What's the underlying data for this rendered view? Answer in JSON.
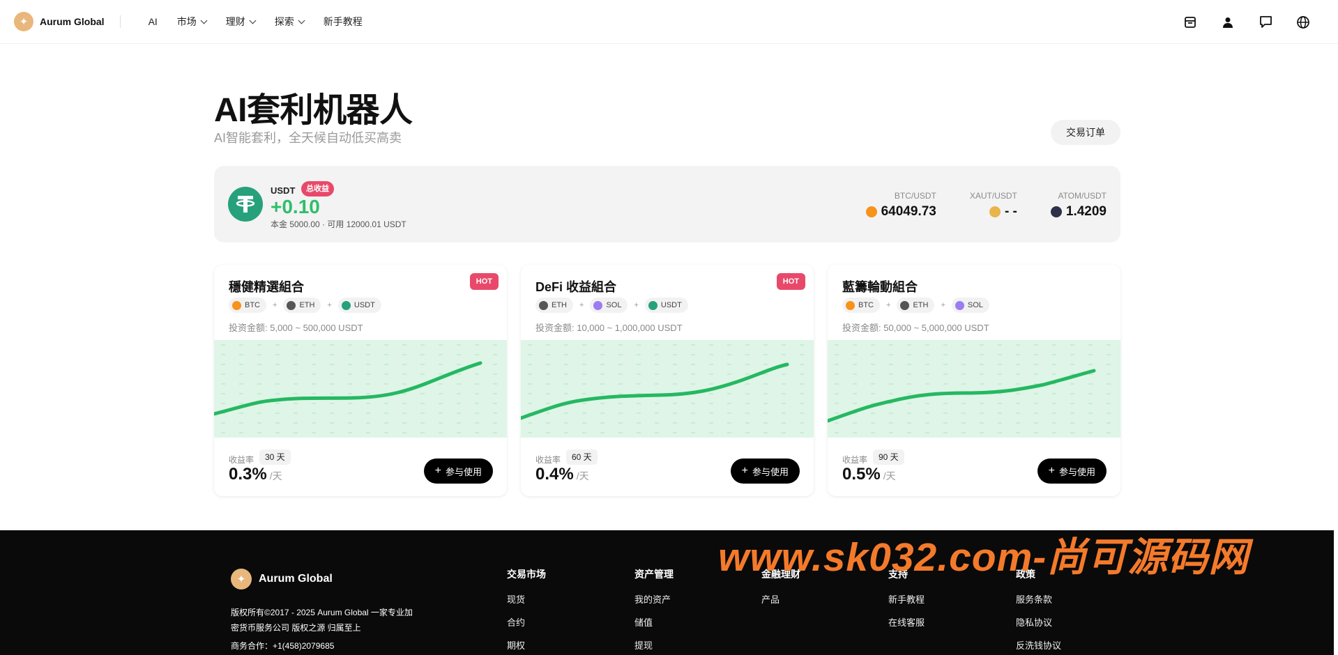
{
  "header": {
    "brand": "Aurum Global",
    "nav": [
      {
        "label": "AI",
        "dropdown": false
      },
      {
        "label": "市场",
        "dropdown": true
      },
      {
        "label": "理财",
        "dropdown": true
      },
      {
        "label": "探索",
        "dropdown": true
      },
      {
        "label": "新手教程",
        "dropdown": false
      }
    ],
    "icons": [
      "wallet-icon",
      "user-icon",
      "chat-icon",
      "globe-icon"
    ]
  },
  "page": {
    "title": "AI套利机器人",
    "subtitle": "AI智能套利，全天候自动低买高卖",
    "orders_button": "交易订单"
  },
  "summary": {
    "currency": "USDT",
    "badge": "总收益",
    "profit": "+0.10",
    "capital": "本金 5000.00 · 可用 12000.01 USDT",
    "tickers": [
      {
        "pair": "BTC/USDT",
        "price": "64049.73",
        "color": "#f7931a"
      },
      {
        "pair": "XAUT/USDT",
        "price": "- -",
        "color": "#e9b44c"
      },
      {
        "pair": "ATOM/USDT",
        "price": "1.4209",
        "color": "#2e3148"
      }
    ]
  },
  "cards": [
    {
      "title": "穩健精選組合",
      "hot": "HOT",
      "coins": [
        {
          "name": "BTC",
          "color": "#f7931a"
        },
        {
          "name": "ETH",
          "color": "#555555"
        },
        {
          "name": "USDT",
          "color": "#26a17b"
        }
      ],
      "range": "投资金额: 5,000 ~ 500,000 USDT",
      "rate_label": "收益率",
      "days": "30 天",
      "rate": "0.3%",
      "unit": "/天",
      "button": "参与使用"
    },
    {
      "title": "DeFi 收益組合",
      "hot": "HOT",
      "coins": [
        {
          "name": "ETH",
          "color": "#555555"
        },
        {
          "name": "SOL",
          "color": "#9b7cf2"
        },
        {
          "name": "USDT",
          "color": "#26a17b"
        }
      ],
      "range": "投资金额: 10,000 ~ 1,000,000 USDT",
      "rate_label": "收益率",
      "days": "60 天",
      "rate": "0.4%",
      "unit": "/天",
      "button": "参与使用"
    },
    {
      "title": "藍籌輪動組合",
      "hot": "",
      "coins": [
        {
          "name": "BTC",
          "color": "#f7931a"
        },
        {
          "name": "ETH",
          "color": "#555555"
        },
        {
          "name": "SOL",
          "color": "#9b7cf2"
        }
      ],
      "range": "投资金额: 50,000 ~ 5,000,000 USDT",
      "rate_label": "收益率",
      "days": "90 天",
      "rate": "0.5%",
      "unit": "/天",
      "button": "参与使用"
    }
  ],
  "footer": {
    "brand": "Aurum Global",
    "copyright": "版权所有©2017 - 2025 Aurum Global 一家专业加密货币服务公司 版权之源 归属至上",
    "business": "商务合作：+1(458)2079685",
    "columns": [
      {
        "title": "交易市场",
        "links": [
          "现货",
          "合约",
          "期权"
        ]
      },
      {
        "title": "资产管理",
        "links": [
          "我的资产",
          "储值",
          "提现"
        ]
      },
      {
        "title": "金融理财",
        "links": [
          "产品"
        ]
      },
      {
        "title": "支持",
        "links": [
          "新手教程",
          "在线客服"
        ]
      },
      {
        "title": "政策",
        "links": [
          "服务条款",
          "隐私协议",
          "反洗钱协议"
        ]
      }
    ]
  },
  "watermark": "www.sk032.com-尚可源码网"
}
